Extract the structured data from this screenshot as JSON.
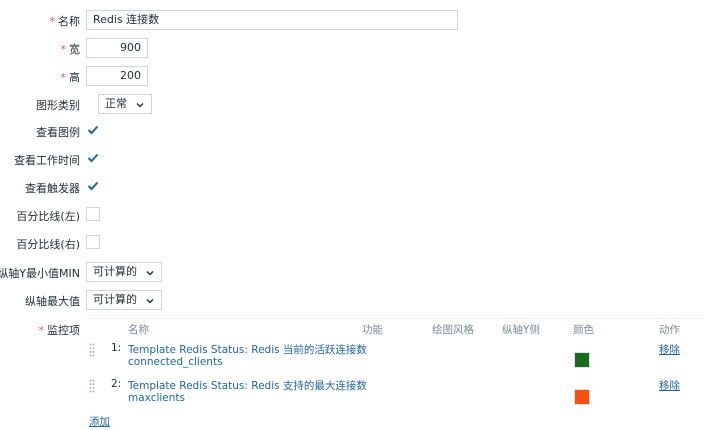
{
  "form": {
    "name": {
      "label": "名称",
      "value": "Redis 连接数"
    },
    "width": {
      "label": "宽",
      "value": "900"
    },
    "height": {
      "label": "高",
      "value": "200"
    },
    "graph_type": {
      "label": "图形类别",
      "value": "正常"
    },
    "show_legend": {
      "label": "查看图例",
      "checked": true
    },
    "show_work_period": {
      "label": "查看工作时间",
      "checked": true
    },
    "show_triggers": {
      "label": "查看触发器",
      "checked": true
    },
    "percentile_left": {
      "label": "百分比线(左)",
      "checked": false
    },
    "percentile_right": {
      "label": "百分比线(右)",
      "checked": false
    },
    "y_min": {
      "label": "纵轴Y最小值MIN",
      "value": "可计算的"
    },
    "y_max": {
      "label": "纵轴最大值",
      "value": "可计算的"
    }
  },
  "items": {
    "label": "监控项",
    "headers": {
      "name": "名称",
      "function": "功能",
      "draw_style": "绘图风格",
      "y_axis": "纵轴Y侧",
      "color": "颜色",
      "action": "动作"
    },
    "rows": [
      {
        "index": "1:",
        "name_line1": "Template Redis Status: Redis 当前的活跃连接数",
        "name_line2": "connected_clients",
        "color": "#1a6b1a",
        "remove": "移除"
      },
      {
        "index": "2:",
        "name_line1": "Template Redis Status: Redis 支持的最大连接数",
        "name_line2": "maxclients",
        "color": "#ff4f0f",
        "remove": "移除"
      }
    ],
    "add": "添加"
  }
}
